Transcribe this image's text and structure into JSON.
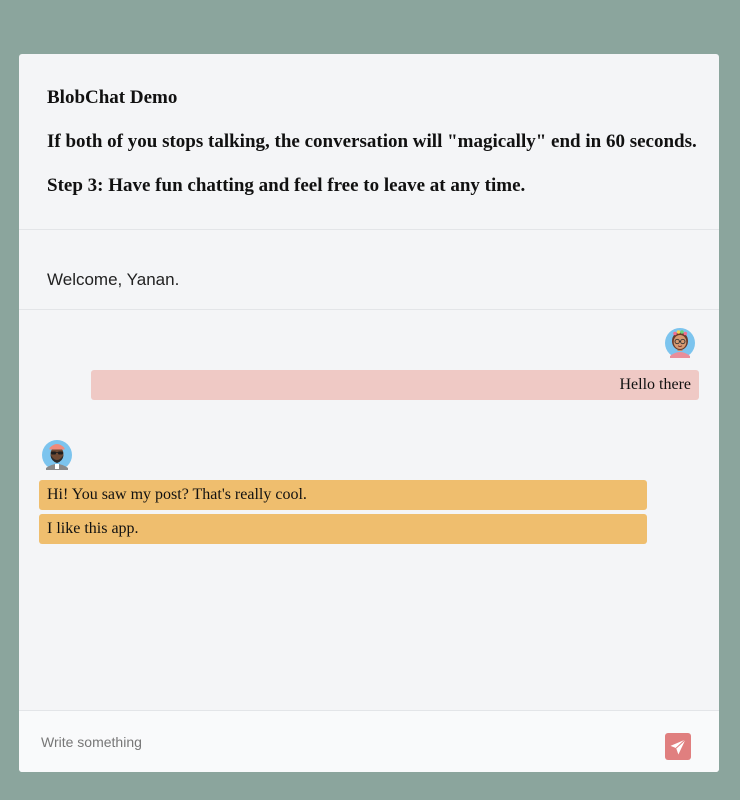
{
  "header": {
    "title": "BlobChat Demo",
    "notice": "If both of you stops talking, the conversation will \"magically\" end in 60 seconds.",
    "step": "Step 3: Have fun chatting and feel free to leave at any time."
  },
  "welcome": {
    "text": "Welcome, Yanan."
  },
  "messages": [
    {
      "sender": "self",
      "avatar": "woman-with-glasses-avatar",
      "text": "Hello there"
    },
    {
      "sender": "other",
      "avatar": "man-with-sunglasses-avatar",
      "text": "Hi! You saw my post? That's really cool."
    },
    {
      "sender": "other",
      "avatar": "",
      "text": "I like this app."
    }
  ],
  "composer": {
    "placeholder": "Write something",
    "value": "",
    "send_icon": "paper-plane-icon"
  },
  "colors": {
    "page_background": "#8ba59d",
    "panel_background": "#f4f5f7",
    "own_bubble": "#efc9c5",
    "other_bubble": "#efbe6e",
    "send_button": "#e07f7f"
  }
}
